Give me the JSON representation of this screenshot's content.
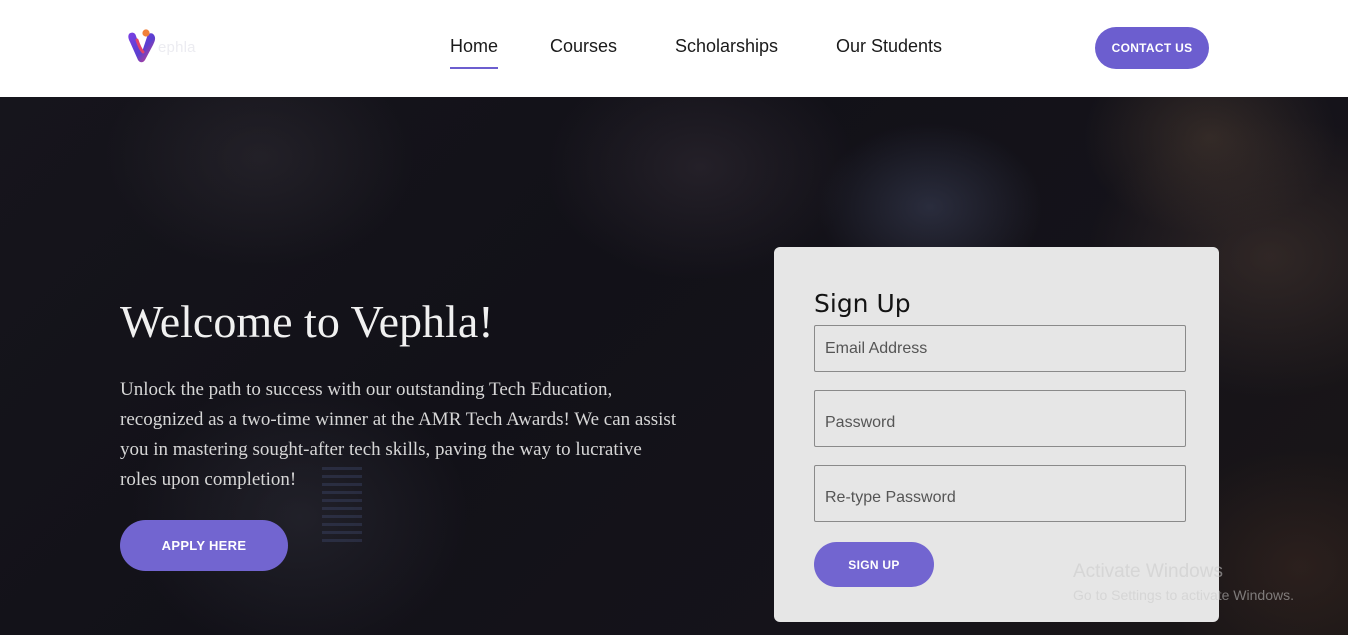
{
  "brand": {
    "name": "Vephla",
    "logo_text": "ephla",
    "accent_color": "#6c5ecf"
  },
  "nav": {
    "items": [
      {
        "label": "Home",
        "active": true
      },
      {
        "label": "Courses",
        "active": false
      },
      {
        "label": "Scholarships",
        "active": false
      },
      {
        "label": "Our Students",
        "active": false
      }
    ],
    "contact_label": "CONTACT US"
  },
  "hero": {
    "title": "Welcome to Vephla!",
    "text": "Unlock the path to success with our outstanding Tech Education, recognized as a two-time winner at the AMR Tech Awards! We can assist you in mastering sought-after tech skills, paving the way to lucrative roles upon completion!",
    "apply_label": "APPLY HERE"
  },
  "signup": {
    "title": "Sign Up",
    "email_placeholder": "Email Address",
    "password_placeholder": "Password",
    "retype_placeholder": "Re-type Password",
    "submit_label": "SIGN UP"
  },
  "watermark": {
    "title": "Activate Windows",
    "subtitle": "Go to Settings to activate Windows."
  }
}
